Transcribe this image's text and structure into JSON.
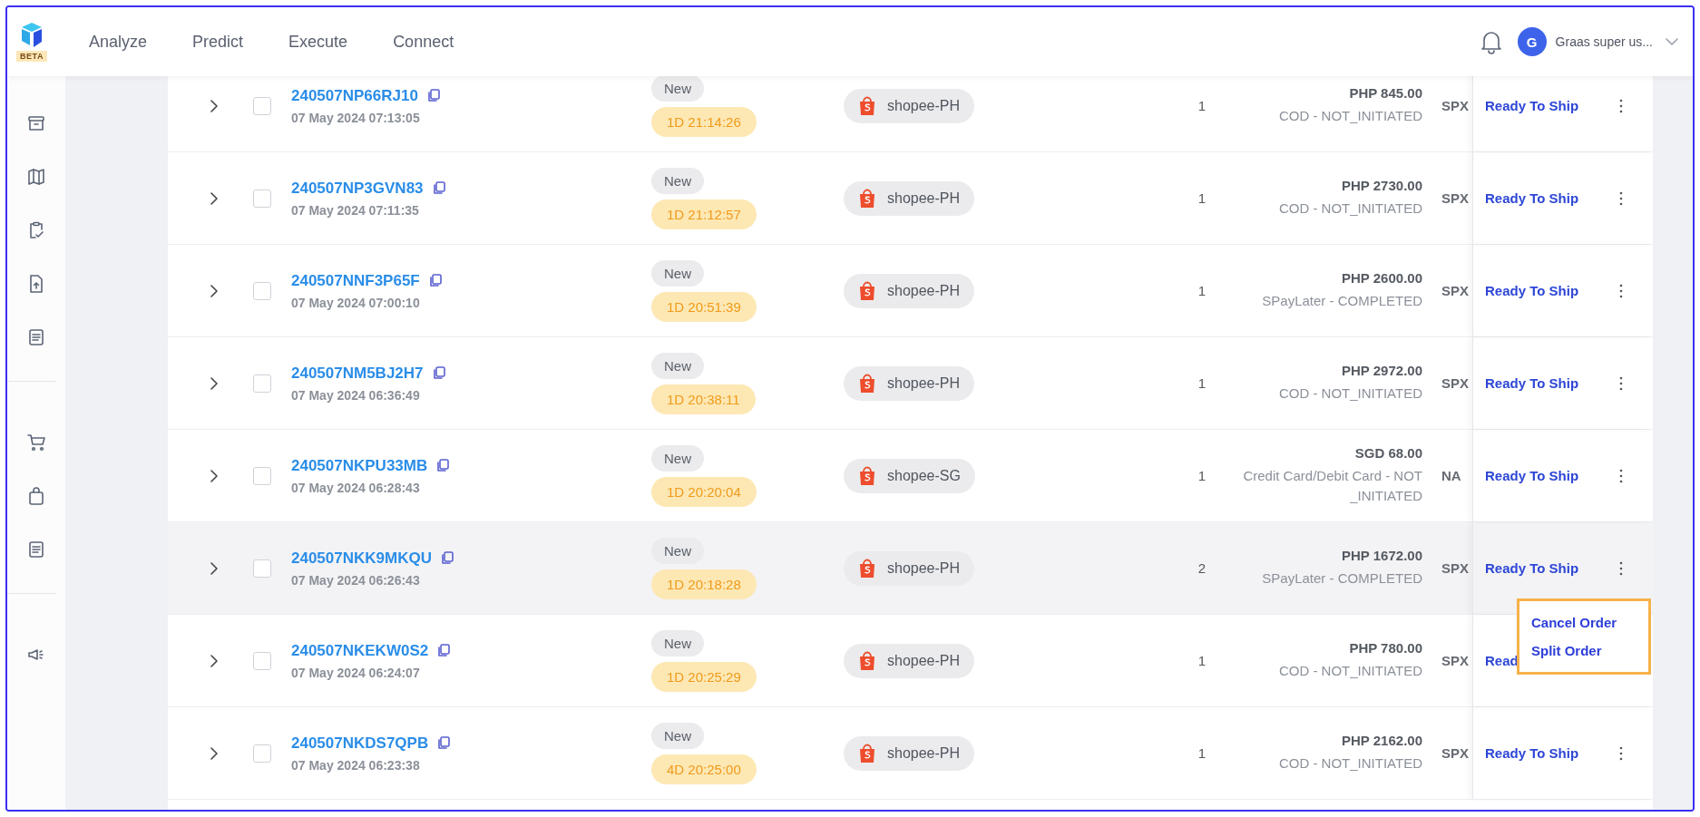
{
  "logo": {
    "badge": "BETA"
  },
  "nav": [
    {
      "label": "Analyze"
    },
    {
      "label": "Predict"
    },
    {
      "label": "Execute"
    },
    {
      "label": "Connect"
    }
  ],
  "user": {
    "initial": "G",
    "name": "Graas super us..."
  },
  "rows": [
    {
      "order_id": "240507NP66RJ10",
      "date": "07 May 2024 07:13:05",
      "status": "New",
      "timer": "1D 21:14:26",
      "channel": "shopee-PH",
      "qty": "1",
      "amount": "PHP 845.00",
      "payment": "COD - NOT_INITIATED",
      "carrier": "SPX",
      "action": "Ready To Ship",
      "checked": false,
      "highlighted": false
    },
    {
      "order_id": "240507NP3GVN83",
      "date": "07 May 2024 07:11:35",
      "status": "New",
      "timer": "1D 21:12:57",
      "channel": "shopee-PH",
      "qty": "1",
      "amount": "PHP 2730.00",
      "payment": "COD - NOT_INITIATED",
      "carrier": "SPX",
      "action": "Ready To Ship",
      "checked": false,
      "highlighted": false
    },
    {
      "order_id": "240507NNF3P65F",
      "date": "07 May 2024 07:00:10",
      "status": "New",
      "timer": "1D 20:51:39",
      "channel": "shopee-PH",
      "qty": "1",
      "amount": "PHP 2600.00",
      "payment": "SPayLater - COMPLETED",
      "carrier": "SPX",
      "action": "Ready To Ship",
      "checked": false,
      "highlighted": false
    },
    {
      "order_id": "240507NM5BJ2H7",
      "date": "07 May 2024 06:36:49",
      "status": "New",
      "timer": "1D 20:38:11",
      "channel": "shopee-PH",
      "qty": "1",
      "amount": "PHP 2972.00",
      "payment": "COD - NOT_INITIATED",
      "carrier": "SPX",
      "action": "Ready To Ship",
      "checked": false,
      "highlighted": false
    },
    {
      "order_id": "240507NKPU33MB",
      "date": "07 May 2024 06:28:43",
      "status": "New",
      "timer": "1D 20:20:04",
      "channel": "shopee-SG",
      "qty": "1",
      "amount": "SGD 68.00",
      "payment": "Credit Card/Debit Card - NOT_INITIATED",
      "carrier": "NA",
      "action": "Ready To Ship",
      "checked": false,
      "highlighted": false
    },
    {
      "order_id": "240507NKK9MKQU",
      "date": "07 May 2024 06:26:43",
      "status": "New",
      "timer": "1D 20:18:28",
      "channel": "shopee-PH",
      "qty": "2",
      "amount": "PHP 1672.00",
      "payment": "SPayLater - COMPLETED",
      "carrier": "SPX",
      "action": "Ready To Ship",
      "checked": false,
      "highlighted": true
    },
    {
      "order_id": "240507NKEKW0S2",
      "date": "07 May 2024 06:24:07",
      "status": "New",
      "timer": "1D 20:25:29",
      "channel": "shopee-PH",
      "qty": "1",
      "amount": "PHP 780.00",
      "payment": "COD - NOT_INITIATED",
      "carrier": "SPX",
      "action": "Read",
      "checked": false,
      "highlighted": false
    },
    {
      "order_id": "240507NKDS7QPB",
      "date": "07 May 2024 06:23:38",
      "status": "New",
      "timer": "4D 20:25:00",
      "channel": "shopee-PH",
      "qty": "1",
      "amount": "PHP 2162.00",
      "payment": "COD - NOT_INITIATED",
      "carrier": "SPX",
      "action": "Ready To Ship",
      "checked": false,
      "highlighted": false
    }
  ],
  "row_menu": {
    "items": [
      {
        "label": "Cancel Order"
      },
      {
        "label": "Split Order"
      }
    ]
  }
}
